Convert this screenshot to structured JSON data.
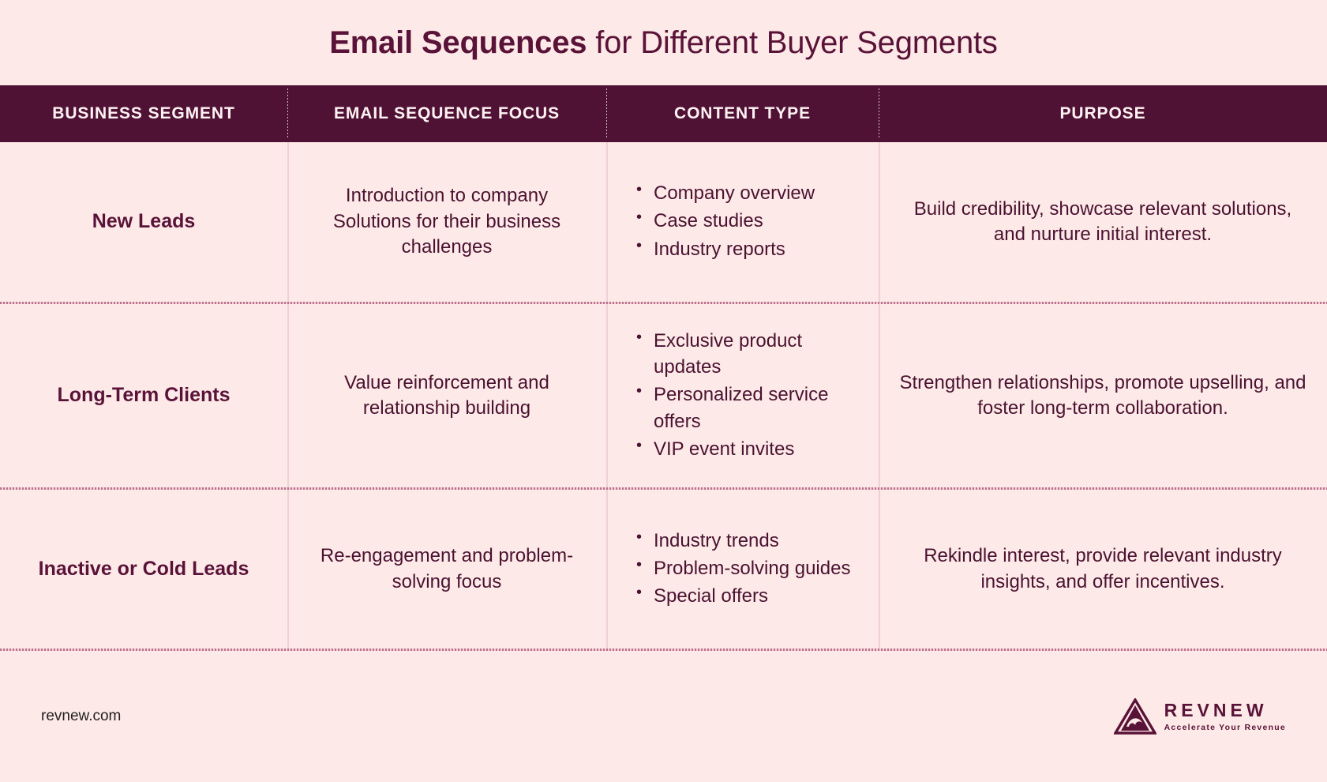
{
  "title": {
    "bold_part": "Email Sequences",
    "regular_part": " for Different Buyer Segments"
  },
  "colors": {
    "page_background": "#FDE9E7",
    "header_background": "#4F1235",
    "header_text": "#FFF2F2",
    "body_text": "#4A1231",
    "accent": "#5A1338",
    "divider": "#EFD0D8",
    "row_separator": "#B9738F"
  },
  "table": {
    "columns": [
      {
        "label": "BUSINESS SEGMENT"
      },
      {
        "label": "EMAIL SEQUENCE FOCUS"
      },
      {
        "label": "CONTENT TYPE"
      },
      {
        "label": "PURPOSE"
      }
    ],
    "rows": [
      {
        "segment": "New Leads",
        "focus": "Introduction to company Solutions for their business challenges",
        "content_type": [
          "Company overview",
          "Case studies",
          "Industry reports"
        ],
        "purpose": "Build credibility, showcase relevant solutions, and nurture initial interest."
      },
      {
        "segment": "Long-Term Clients",
        "focus": "Value reinforcement and relationship building",
        "content_type": [
          "Exclusive product updates",
          "Personalized service offers",
          "VIP event invites"
        ],
        "purpose": "Strengthen relationships, promote upselling, and foster long-term collaboration."
      },
      {
        "segment": "Inactive or Cold Leads",
        "focus": "Re-engagement and problem-solving focus",
        "content_type": [
          "Industry trends",
          "Problem-solving guides",
          "Special offers"
        ],
        "purpose": "Rekindle interest, provide relevant industry insights, and offer incentives."
      }
    ]
  },
  "footer": {
    "url": "revnew.com",
    "logo": {
      "name": "REVNEW",
      "tagline": "Accelerate Your Revenue",
      "mark": "triangle-wave-icon"
    }
  }
}
